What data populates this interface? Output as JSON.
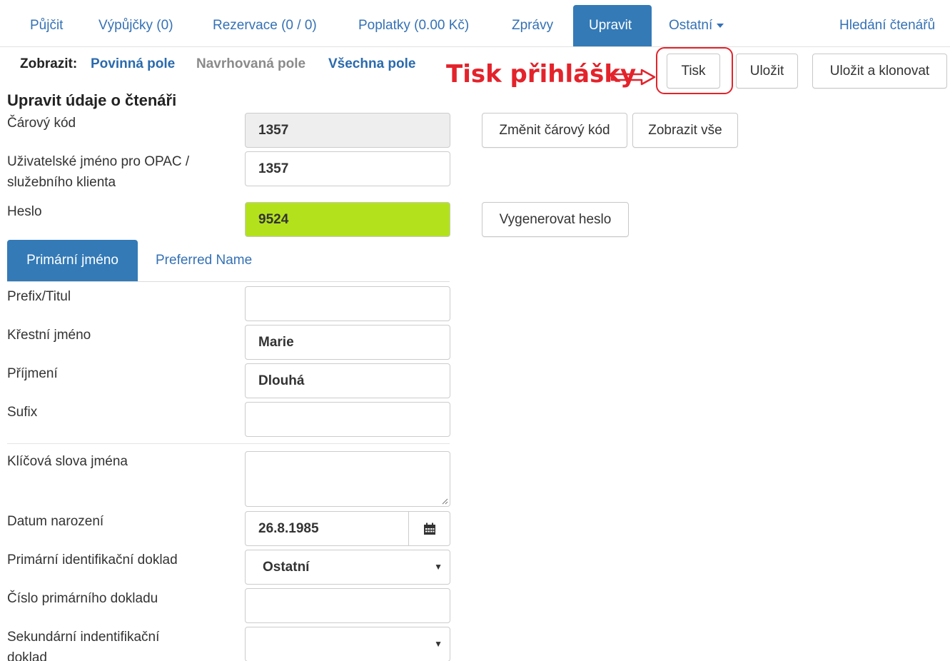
{
  "nav": {
    "items": [
      {
        "label": "Půjčit"
      },
      {
        "label": "Výpůjčky (0)"
      },
      {
        "label": "Rezervace (0 / 0)"
      },
      {
        "label": "Poplatky (0.00 Kč)"
      },
      {
        "label": "Zprávy"
      },
      {
        "label": "Upravit"
      },
      {
        "label": "Ostatní"
      },
      {
        "label": "Hledání čtenářů"
      }
    ],
    "active": "Upravit"
  },
  "toolbar": {
    "show_label": "Zobrazit:",
    "show_links": [
      {
        "label": "Povinná pole",
        "color": "#2a6aad"
      },
      {
        "label": "Navrhovaná pole",
        "color": "#8a8a8a"
      },
      {
        "label": "Všechna pole",
        "color": "#2a6aad"
      }
    ],
    "print_label": "Tisk",
    "save_label": "Uložit",
    "save_clone_label": "Uložit a klonovat"
  },
  "annotation": {
    "text": "Tisk přihlášky",
    "color": "#e3232b"
  },
  "form": {
    "title": "Upravit údaje o čtenáři",
    "barcode": {
      "label": "Čárový kód",
      "value": "1357",
      "change_button": "Změnit čárový kód",
      "show_all_button": "Zobrazit vše"
    },
    "username": {
      "label": "Uživatelské jméno pro OPAC / služebního klienta",
      "value": "1357"
    },
    "password": {
      "label": "Heslo",
      "value": "9524",
      "generate_button": "Vygenerovat heslo",
      "highlight_color": "#b3e21c"
    },
    "name_tabs": [
      {
        "label": "Primární jméno"
      },
      {
        "label": "Preferred Name"
      }
    ],
    "prefix": {
      "label": "Prefix/Titul",
      "value": ""
    },
    "first_name": {
      "label": "Křestní jméno",
      "value": "Marie"
    },
    "last_name": {
      "label": "Příjmení",
      "value": "Dlouhá"
    },
    "suffix": {
      "label": "Sufix",
      "value": ""
    },
    "name_keywords": {
      "label": "Klíčová slova jména",
      "value": ""
    },
    "birth_date": {
      "label": "Datum narození",
      "value": "26.8.1985",
      "icon": "calendar-icon"
    },
    "primary_id": {
      "label": "Primární identifikační doklad",
      "value": "Ostatní"
    },
    "primary_id_number": {
      "label": "Číslo primárního dokladu",
      "value": ""
    },
    "secondary_id": {
      "label": "Sekundární indentifikační doklad",
      "value": ""
    }
  }
}
